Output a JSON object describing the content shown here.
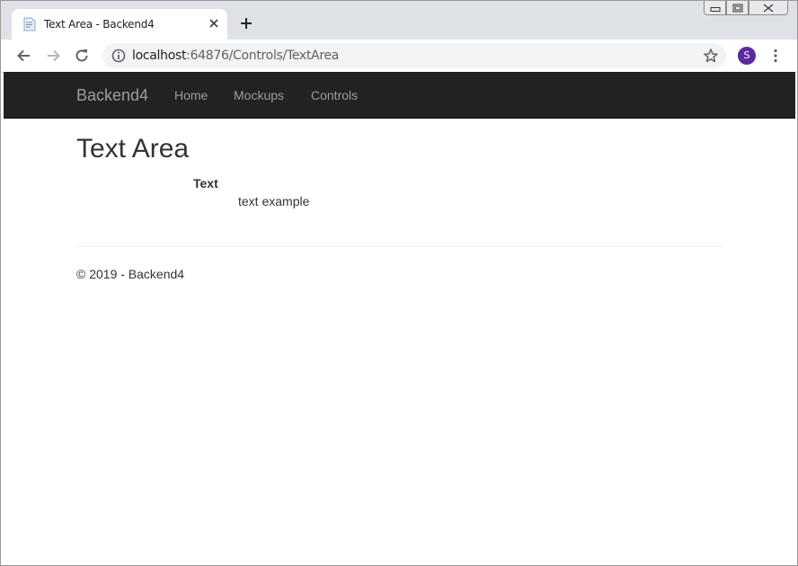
{
  "browser": {
    "tab_title": "Text Area - Backend4",
    "url_host": "localhost",
    "url_rest": ":64876/Controls/TextArea",
    "profile_initial": "S",
    "profile_color": "#5b2aa0",
    "icons": {
      "favicon": "document-icon",
      "tab_close": "close-icon",
      "new_tab": "plus-icon",
      "back": "arrow-left-icon",
      "forward": "arrow-right-icon",
      "reload": "reload-icon",
      "site_info": "info-icon",
      "bookmark": "star-icon",
      "menu": "kebab-menu-icon",
      "minimize": "minimize-icon",
      "restore": "restore-icon",
      "close_window": "close-icon"
    }
  },
  "navbar": {
    "brand": "Backend4",
    "links": [
      {
        "label": "Home"
      },
      {
        "label": "Mockups"
      },
      {
        "label": "Controls"
      }
    ],
    "background": "#222222"
  },
  "main": {
    "title": "Text Area",
    "field_label": "Text",
    "field_value": "text example"
  },
  "footer": {
    "text": "© 2019 - Backend4"
  }
}
